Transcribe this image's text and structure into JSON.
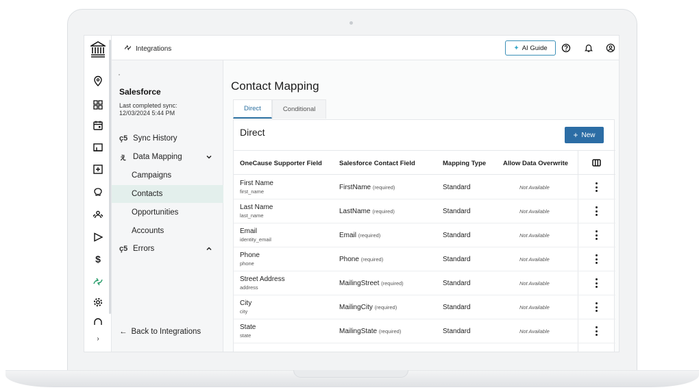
{
  "topbar": {
    "title": "Integrations",
    "ai_guide": "AI Guide"
  },
  "sidenav": {
    "title": "Salesforce",
    "sync_label": "Last completed sync:",
    "sync_time": "12/03/2024 5:44 PM",
    "items": [
      {
        "label": "Sync History"
      },
      {
        "label": "Data Mapping"
      },
      {
        "label": "Campaigns"
      },
      {
        "label": "Contacts"
      },
      {
        "label": "Opportunities"
      },
      {
        "label": "Accounts"
      },
      {
        "label": "Errors"
      }
    ],
    "back": "Back to Integrations"
  },
  "main": {
    "title": "Contact Mapping",
    "tabs": [
      {
        "label": "Direct"
      },
      {
        "label": "Conditional"
      }
    ],
    "panel_title": "Direct",
    "new_button": "New",
    "headers": [
      "OneCause Supporter Field",
      "Salesforce Contact Field",
      "Mapping Type",
      "Allow Data Overwrite"
    ],
    "rows": [
      {
        "name": "First Name",
        "key": "first_name",
        "sf": "FirstName",
        "req": "(required)",
        "type": "Standard",
        "overwrite": "Not Available"
      },
      {
        "name": "Last Name",
        "key": "last_name",
        "sf": "LastName",
        "req": "(required)",
        "type": "Standard",
        "overwrite": "Not Available"
      },
      {
        "name": "Email",
        "key": "identity_email",
        "sf": "Email",
        "req": "(required)",
        "type": "Standard",
        "overwrite": "Not Available"
      },
      {
        "name": "Phone",
        "key": "phone",
        "sf": "Phone",
        "req": "(required)",
        "type": "Standard",
        "overwrite": "Not Available"
      },
      {
        "name": "Street Address",
        "key": "address",
        "sf": "MailingStreet",
        "req": "(required)",
        "type": "Standard",
        "overwrite": "Not Available"
      },
      {
        "name": "City",
        "key": "city",
        "sf": "MailingCity",
        "req": "(required)",
        "type": "Standard",
        "overwrite": "Not Available"
      },
      {
        "name": "State",
        "key": "state",
        "sf": "MailingState",
        "req": "(required)",
        "type": "Standard",
        "overwrite": "Not Available"
      }
    ]
  },
  "colors": {
    "accent_blue": "#2c6da5",
    "active_green": "#2a9d6b",
    "active_nav_bg": "#e3efec"
  }
}
